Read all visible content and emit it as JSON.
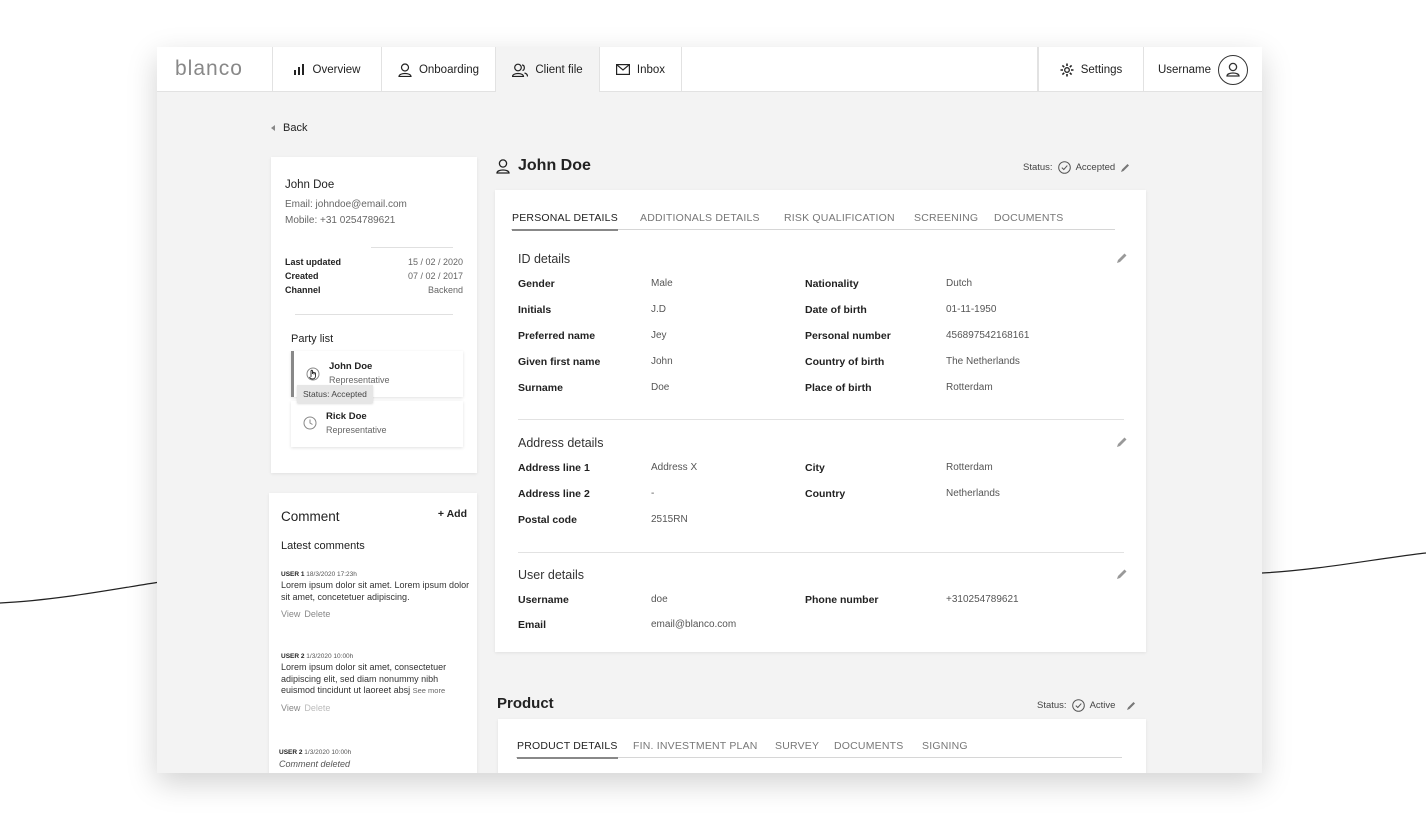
{
  "logo": "blanco",
  "nav": {
    "items": [
      {
        "label": "Overview",
        "icon": "bar-chart-icon"
      },
      {
        "label": "Onboarding",
        "icon": "user-icon"
      },
      {
        "label": "Client file",
        "icon": "users-icon"
      },
      {
        "label": "Inbox",
        "icon": "mail-icon"
      }
    ],
    "settings": "Settings",
    "username": "Username"
  },
  "back": "Back",
  "client": {
    "name": "John Doe",
    "email": "Email: johndoe@email.com",
    "mobile": "Mobile: +31 0254789621",
    "meta": [
      {
        "key": "Last updated",
        "value": "15 / 02 / 2020"
      },
      {
        "key": "Created",
        "value": "07 / 02 / 2017"
      },
      {
        "key": "Channel",
        "value": "Backend"
      }
    ]
  },
  "party": {
    "title": "Party list",
    "items": [
      {
        "name": "John Doe",
        "role": "Representative"
      },
      {
        "name": "Rick Doe",
        "role": "Representative"
      }
    ],
    "tooltip": "Status: Accepted"
  },
  "comments": {
    "title": "Comment",
    "add": "+ Add",
    "latest": "Latest comments",
    "entries": [
      {
        "user": "USER 1",
        "date": "18/3/2020 17:23h",
        "text": "Lorem ipsum dolor sit amet. Lorem ipsum dolor sit amet, concetetuer adipiscing.",
        "view": "View",
        "delete": "Delete"
      },
      {
        "user": "USER 2",
        "date": "1/3/2020 10:00h",
        "text": "Lorem ipsum dolor sit amet, consectetuer adipiscing elit, sed diam nonummy nibh euismod tincidunt ut laoreet absj",
        "more": "See more",
        "view": "View",
        "delete": "Delete"
      },
      {
        "user": "USER 2",
        "date": "1/3/2020 10:00h",
        "deleted": "Comment deleted"
      }
    ]
  },
  "main": {
    "title": "John Doe",
    "status_label": "Status:",
    "status_value": "Accepted",
    "tabs": [
      "PERSONAL DETAILS",
      "ADDITIONALS DETAILS",
      "RISK QUALIFICATION",
      "SCREENING",
      "DOCUMENTS"
    ],
    "id_details": {
      "title": "ID details",
      "left": [
        {
          "label": "Gender",
          "value": "Male"
        },
        {
          "label": "Initials",
          "value": "J.D"
        },
        {
          "label": "Preferred name",
          "value": "Jey"
        },
        {
          "label": "Given first name",
          "value": "John"
        },
        {
          "label": "Surname",
          "value": "Doe"
        }
      ],
      "right": [
        {
          "label": "Nationality",
          "value": "Dutch"
        },
        {
          "label": "Date of birth",
          "value": "01-11-1950"
        },
        {
          "label": "Personal number",
          "value": "456897542168161"
        },
        {
          "label": "Country of birth",
          "value": "The Netherlands"
        },
        {
          "label": "Place of birth",
          "value": "Rotterdam"
        }
      ]
    },
    "address_details": {
      "title": "Address details",
      "left": [
        {
          "label": "Address line 1",
          "value": "Address X"
        },
        {
          "label": "Address line 2",
          "value": "-"
        },
        {
          "label": "Postal code",
          "value": "2515RN"
        }
      ],
      "right": [
        {
          "label": "City",
          "value": "Rotterdam"
        },
        {
          "label": "Country",
          "value": "Netherlands"
        }
      ]
    },
    "user_details": {
      "title": "User details",
      "left": [
        {
          "label": "Username",
          "value": "doe"
        },
        {
          "label": "Email",
          "value": "email@blanco.com"
        }
      ],
      "right": [
        {
          "label": "Phone number",
          "value": "+310254789621"
        }
      ]
    }
  },
  "product": {
    "title": "Product",
    "status_label": "Status:",
    "status_value": "Active",
    "tabs": [
      "PRODUCT DETAILS",
      "FIN. INVESTMENT PLAN",
      "SURVEY",
      "DOCUMENTS",
      "SIGNING"
    ]
  }
}
